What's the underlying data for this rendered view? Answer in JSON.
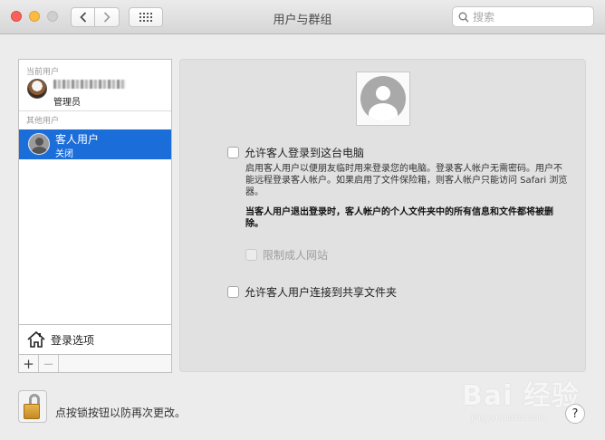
{
  "window": {
    "title": "用户与群组"
  },
  "toolbar": {
    "back_icon": "chevron-left-icon",
    "forward_icon": "chevron-right-icon",
    "grid_icon": "grid-icon"
  },
  "search": {
    "placeholder": "搜索"
  },
  "sidebar": {
    "current_users_header": "当前用户",
    "current_user": {
      "role": "管理员"
    },
    "other_users_header": "其他用户",
    "guest": {
      "name": "客人用户",
      "status": "关闭"
    },
    "login_options_label": "登录选项",
    "add_label": "+",
    "remove_label": "−"
  },
  "detail": {
    "allow_guest_login": {
      "label": "允许客人登录到这台电脑",
      "checked": false
    },
    "description": "启用客人用户以便朋友临时用来登录您的电脑。登录客人帐户无需密码。用户不能远程登录客人帐户。如果启用了文件保险箱，则客人帐户只能访问 Safari 浏览器。",
    "warning": "当客人用户退出登录时，客人帐户的个人文件夹中的所有信息和文件都将被删除。",
    "limit_adult_sites": {
      "label": "限制成人网站",
      "checked": false,
      "enabled": false
    },
    "allow_shared_folders": {
      "label": "允许客人用户连接到共享文件夹",
      "checked": false
    }
  },
  "footer": {
    "lock_text": "点按锁按钮以防再次更改。",
    "help_label": "?"
  },
  "watermark": {
    "text": "Bai 经验",
    "sub": "jingyan.baidu.com"
  }
}
